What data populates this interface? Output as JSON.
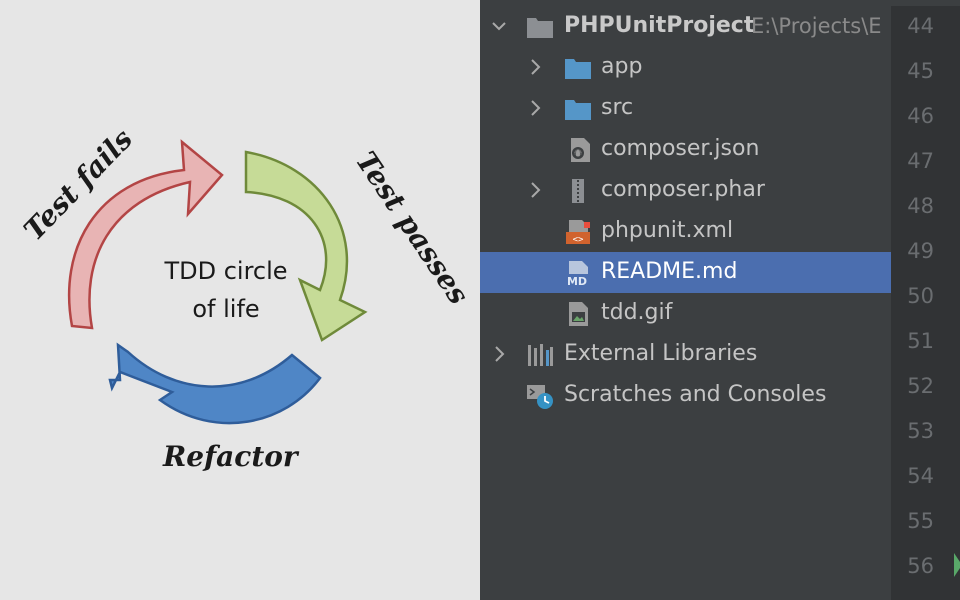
{
  "diagram": {
    "center_line1": "TDD circle",
    "center_line2": "of life",
    "label_fails": "Test fails",
    "label_passes": "Test passes",
    "label_refactor": "Refactor",
    "colors": {
      "red": "#e8b4b4",
      "red_stroke": "#b34545",
      "green": "#c6db97",
      "green_stroke": "#6f8a3a",
      "blue": "#4f86c6",
      "blue_stroke": "#2f5d9a"
    }
  },
  "project_tree": {
    "root": {
      "name": "PHPUnitProject",
      "path": "E:\\Projects\\E",
      "icon": "folder-icon"
    },
    "items": [
      {
        "label": "app",
        "icon": "folder-icon",
        "expandable": true
      },
      {
        "label": "src",
        "icon": "folder-icon",
        "expandable": true
      },
      {
        "label": "composer.json",
        "icon": "json-file-icon",
        "expandable": false
      },
      {
        "label": "composer.phar",
        "icon": "archive-icon",
        "expandable": true
      },
      {
        "label": "phpunit.xml",
        "icon": "phpunit-xml-icon",
        "expandable": false
      },
      {
        "label": "README.md",
        "icon": "markdown-icon",
        "expandable": false,
        "selected": true
      },
      {
        "label": "tdd.gif",
        "icon": "image-file-icon",
        "expandable": false
      }
    ],
    "external_libraries": "External Libraries",
    "scratches": "Scratches and Consoles"
  },
  "editor_gutter": {
    "line_numbers": [
      "44",
      "45",
      "46",
      "47",
      "48",
      "49",
      "50",
      "51",
      "52",
      "53",
      "54",
      "55",
      "56"
    ]
  },
  "colors": {
    "tree_bg": "#3c3f41",
    "gutter_bg": "#313335",
    "selection": "#4b6eaf",
    "folder": "#5596c8"
  }
}
